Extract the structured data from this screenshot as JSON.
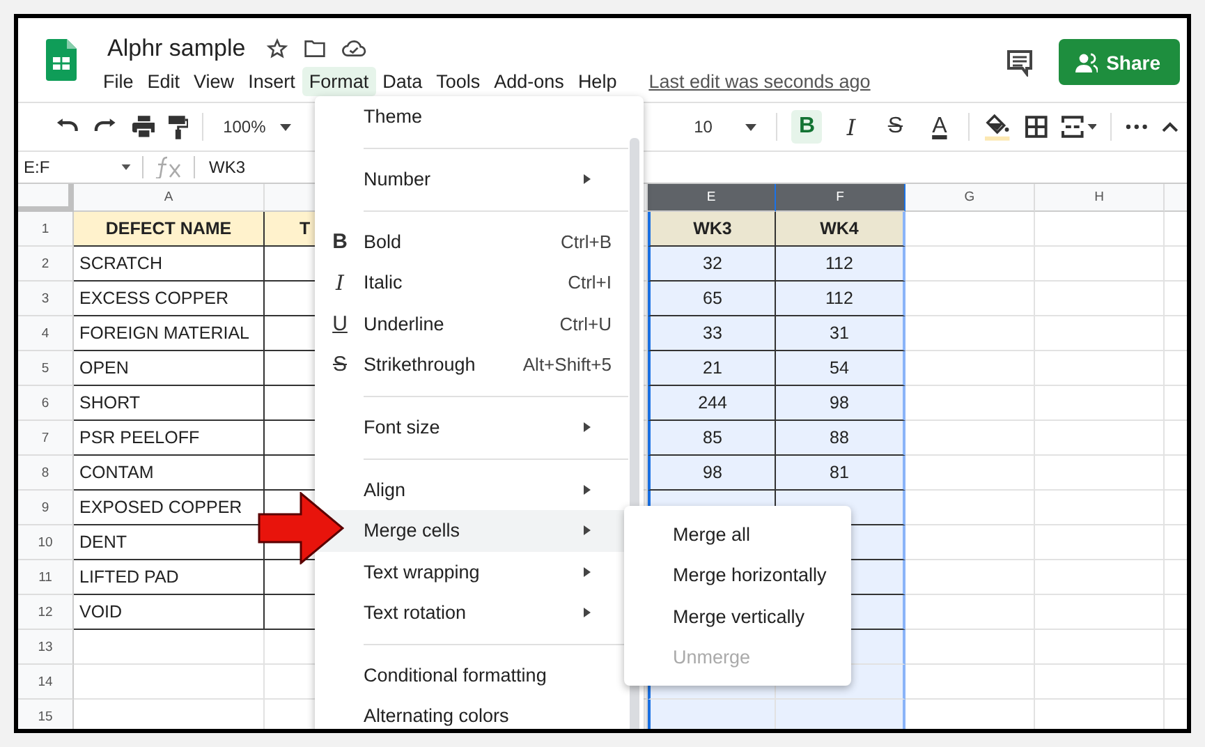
{
  "document": {
    "title": "Alphr sample",
    "last_edit": "Last edit was seconds ago"
  },
  "menubar": [
    {
      "label": "File",
      "selected": false
    },
    {
      "label": "Edit",
      "selected": false
    },
    {
      "label": "View",
      "selected": false
    },
    {
      "label": "Insert",
      "selected": false
    },
    {
      "label": "Format",
      "selected": true
    },
    {
      "label": "Data",
      "selected": false
    },
    {
      "label": "Tools",
      "selected": false
    },
    {
      "label": "Add-ons",
      "selected": false
    },
    {
      "label": "Help",
      "selected": false
    }
  ],
  "share_button": "Share",
  "toolbar": {
    "zoom": "100%",
    "font_size": "10",
    "format_buttons": [
      {
        "glyph": "B",
        "kind": "bold",
        "active": true
      },
      {
        "glyph": "I",
        "kind": "italic",
        "active": false
      },
      {
        "glyph": "S",
        "kind": "strikethrough",
        "active": false
      },
      {
        "glyph": "A",
        "kind": "color",
        "active": false
      }
    ]
  },
  "formula_bar": {
    "name_box": "E:F",
    "value": "WK3"
  },
  "columns": [
    {
      "letter": "A",
      "selected": false
    },
    {
      "letter": "E",
      "selected": true
    },
    {
      "letter": "F",
      "selected": true
    },
    {
      "letter": "G",
      "selected": false
    },
    {
      "letter": "H",
      "selected": false
    }
  ],
  "rows": [
    {
      "number": "1",
      "kind": "header",
      "a": "DEFECT NAME",
      "b": "T",
      "e": "WK3",
      "f": "WK4"
    },
    {
      "number": "2",
      "kind": "data",
      "a": "SCRATCH",
      "e": "32",
      "f": "112"
    },
    {
      "number": "3",
      "kind": "data",
      "a": "EXCESS COPPER",
      "e": "65",
      "f": "112"
    },
    {
      "number": "4",
      "kind": "data",
      "a": "FOREIGN MATERIAL",
      "e": "33",
      "f": "31"
    },
    {
      "number": "5",
      "kind": "data",
      "a": "OPEN",
      "e": "21",
      "f": "54"
    },
    {
      "number": "6",
      "kind": "data",
      "a": "SHORT",
      "e": "244",
      "f": "98"
    },
    {
      "number": "7",
      "kind": "data",
      "a": "PSR PEELOFF",
      "e": "85",
      "f": "88"
    },
    {
      "number": "8",
      "kind": "data",
      "a": "CONTAM",
      "e": "98",
      "f": "81"
    },
    {
      "number": "9",
      "kind": "data",
      "a": "EXPOSED COPPER"
    },
    {
      "number": "10",
      "kind": "data",
      "a": "DENT"
    },
    {
      "number": "11",
      "kind": "data",
      "a": "LIFTED PAD"
    },
    {
      "number": "12",
      "kind": "data",
      "a": "VOID"
    },
    {
      "number": "13",
      "kind": "blank"
    },
    {
      "number": "14",
      "kind": "blank"
    },
    {
      "number": "15",
      "kind": "blank"
    }
  ],
  "format_menu": [
    {
      "kind": "item",
      "label": "Theme",
      "submenu": false,
      "highlighted": false
    },
    {
      "kind": "separator"
    },
    {
      "kind": "item",
      "label": "Number",
      "submenu": true,
      "highlighted": false
    },
    {
      "kind": "separator"
    },
    {
      "kind": "item",
      "icon": {
        "glyph": "B",
        "kind": "bold"
      },
      "label": "Bold",
      "shortcut": "Ctrl+B",
      "submenu": false,
      "highlighted": false
    },
    {
      "kind": "item",
      "icon": {
        "glyph": "I",
        "kind": "italic"
      },
      "label": "Italic",
      "shortcut": "Ctrl+I",
      "submenu": false,
      "highlighted": false
    },
    {
      "kind": "item",
      "icon": {
        "glyph": "U",
        "kind": "underline"
      },
      "label": "Underline",
      "shortcut": "Ctrl+U",
      "submenu": false,
      "highlighted": false
    },
    {
      "kind": "item",
      "icon": {
        "glyph": "S",
        "kind": "strikethrough"
      },
      "label": "Strikethrough",
      "shortcut": "Alt+Shift+5",
      "submenu": false,
      "highlighted": false
    },
    {
      "kind": "separator"
    },
    {
      "kind": "item",
      "label": "Font size",
      "submenu": true,
      "highlighted": false
    },
    {
      "kind": "separator"
    },
    {
      "kind": "item",
      "label": "Align",
      "submenu": true,
      "highlighted": false
    },
    {
      "kind": "item",
      "label": "Merge cells",
      "submenu": true,
      "highlighted": true
    },
    {
      "kind": "item",
      "label": "Text wrapping",
      "submenu": true,
      "highlighted": false
    },
    {
      "kind": "item",
      "label": "Text rotation",
      "submenu": true,
      "highlighted": false
    },
    {
      "kind": "separator"
    },
    {
      "kind": "item",
      "label": "Conditional formatting",
      "submenu": false,
      "highlighted": false
    },
    {
      "kind": "item",
      "label": "Alternating colors",
      "submenu": false,
      "highlighted": false
    }
  ],
  "merge_submenu": [
    {
      "label": "Merge all",
      "disabled": false
    },
    {
      "label": "Merge horizontally",
      "disabled": false
    },
    {
      "label": "Merge vertically",
      "disabled": false
    },
    {
      "label": "Unmerge",
      "disabled": true
    }
  ]
}
